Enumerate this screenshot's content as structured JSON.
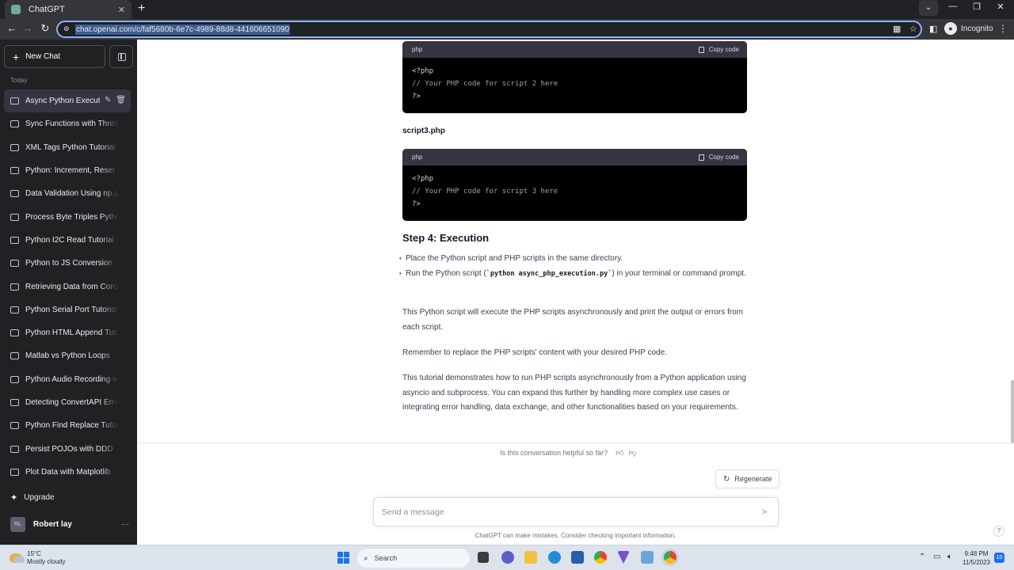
{
  "browser": {
    "tab_title": "ChatGPT",
    "tab_close": "✕",
    "new_tab": "+",
    "url": "chat.openai.com/c/faf5680b-6e7c-4989-88d8-441606651090",
    "incognito_label": "Incognito"
  },
  "sidebar": {
    "new_chat_label": "New Chat",
    "section_label": "Today",
    "items": [
      {
        "label": "Async Python Execute"
      },
      {
        "label": "Sync Functions with Threadin"
      },
      {
        "label": "XML Tags Python Tutorial"
      },
      {
        "label": "Python: Increment, Reset Val"
      },
      {
        "label": "Data Validation Using np.gen"
      },
      {
        "label": "Process Byte Triples Python"
      },
      {
        "label": "Python I2C Read Tutorial"
      },
      {
        "label": "Python to JS Conversion"
      },
      {
        "label": "Retrieving Data from Corouti"
      },
      {
        "label": "Python Serial Port Tutorial"
      },
      {
        "label": "Python HTML Append Tutori"
      },
      {
        "label": "Matlab vs Python Loops"
      },
      {
        "label": "Python Audio Recording with"
      },
      {
        "label": "Detecting ConvertAPI Error C"
      },
      {
        "label": "Python Find Replace Tutorial"
      },
      {
        "label": "Persist POJOs with DDD"
      },
      {
        "label": "Plot Data with Matplotlib"
      }
    ],
    "upgrade_label": "Upgrade",
    "user_initials": "RL",
    "user_name": "Robert lay"
  },
  "content": {
    "code_blocks": [
      {
        "lang": "php",
        "copy_label": "Copy code",
        "line1": "<?php",
        "line2": "// Your PHP code for script 2 here",
        "line3": "?>"
      },
      {
        "lang": "php",
        "copy_label": "Copy code",
        "line1": "<?php",
        "line2": "// Your PHP code for script 3 here",
        "line3": "?>"
      }
    ],
    "filename": "script3.php",
    "heading": "Step 4: Execution",
    "bullet1": "Place the Python script and PHP scripts in the same directory.",
    "bullet2_pre": "Run the Python script (",
    "bullet2_code": "`python async_php_execution.py`",
    "bullet2_post": ") in your terminal or command prompt.",
    "para1": "This Python script will execute the PHP scripts asynchronously and print the output or errors from each script.",
    "para2": "Remember to replace the PHP scripts' content with your desired PHP code.",
    "para3": "This tutorial demonstrates how to run PHP scripts asynchronously from a Python application using asyncio and subprocess. You can expand this further by handling more complex use cases or integrating error handling, data exchange, and other functionalities based on your requirements.",
    "feedback_prompt": "Is this conversation helpful so far?",
    "regenerate_label": "Regenerate",
    "composer_placeholder": "Send a message",
    "disclaimer": "ChatGPT can make mistakes. Consider checking important information.",
    "help": "?"
  },
  "taskbar": {
    "temperature": "15°C",
    "weather": "Mostly cloudy",
    "search_label": "Search",
    "time": "9:48 PM",
    "date": "11/5/2023",
    "notifications": "10"
  },
  "colors": {
    "sidebar_bg": "#202123",
    "active_item_bg": "#343541",
    "code_bg": "#000000",
    "accent_focus": "#8ab4f8"
  }
}
